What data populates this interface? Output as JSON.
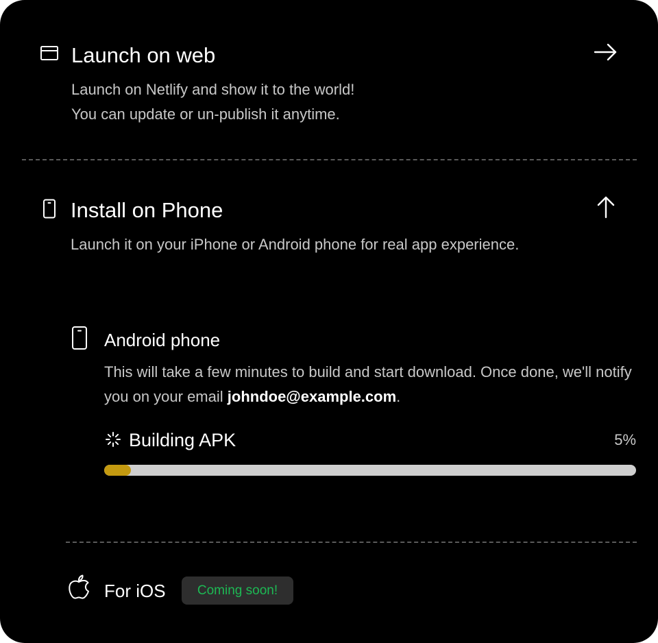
{
  "web": {
    "title": "Launch on web",
    "line1": "Launch on Netlify and show it to the world!",
    "line2": "You can update or un-publish it anytime.",
    "window_icon": "browser-window-icon",
    "arrow_icon": "arrow-right-icon"
  },
  "phone": {
    "title": "Install on Phone",
    "desc": "Launch it on your iPhone or Android phone for real app experience.",
    "phone_icon": "phone-icon",
    "arrow_icon": "arrow-up-icon"
  },
  "android": {
    "title": "Android phone",
    "desc_prefix": "This will take a few minutes to build and start download. Once done, we'll notify you on your email ",
    "email": "johndoe@example.com",
    "desc_suffix": ".",
    "icon": "phone-icon",
    "build": {
      "status": "Building APK",
      "percent_label": "5%",
      "progress": 0.05,
      "icon": "spinner-icon",
      "fill_color": "#c49a10",
      "track_color": "#cfcfcf"
    }
  },
  "ios": {
    "title": "For iOS",
    "badge": "Coming soon!",
    "badge_color": "#1db954",
    "icon": "apple-icon"
  }
}
